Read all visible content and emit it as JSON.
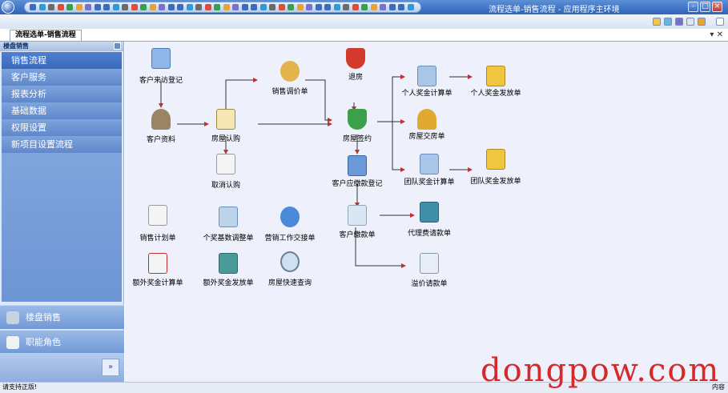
{
  "window": {
    "title": "流程选单-销售流程 - 应用程序主环境"
  },
  "tab": {
    "label": "流程选单-销售流程"
  },
  "sidebar": {
    "header": "楼盘销售",
    "items": [
      {
        "label": "销售流程",
        "selected": true
      },
      {
        "label": "客户服务",
        "selected": false
      },
      {
        "label": "报表分析",
        "selected": false
      },
      {
        "label": "基础数据",
        "selected": false
      },
      {
        "label": "权限设置",
        "selected": false
      },
      {
        "label": "新项目设置流程",
        "selected": false
      }
    ],
    "groups": [
      {
        "label": "楼盘销售",
        "icon": "building-icon"
      },
      {
        "label": "职能角色",
        "icon": "user-role-icon"
      }
    ],
    "more_glyph": "»"
  },
  "flow": {
    "nodes": [
      {
        "id": "visit",
        "label": "客户来访登记",
        "icon": "id-card-icon",
        "color": "#8fb6e8"
      },
      {
        "id": "customer",
        "label": "客户资料",
        "icon": "lock-person-icon",
        "color": "#9a8466"
      },
      {
        "id": "subscribe",
        "label": "房屋认购",
        "icon": "pen-document-icon",
        "color": "#f4e7b3"
      },
      {
        "id": "cancel",
        "label": "取消认购",
        "icon": "cancel-document-icon",
        "color": "#f4f4f4"
      },
      {
        "id": "price",
        "label": "销售调价单",
        "icon": "signing-icon",
        "color": "#e3b34c"
      },
      {
        "id": "return",
        "label": "退房",
        "icon": "red-shield-icon",
        "color": "#d23a2c"
      },
      {
        "id": "contract",
        "label": "房屋签约",
        "icon": "green-shield-icon",
        "color": "#3aa14a"
      },
      {
        "id": "receivable",
        "label": "客户应缴款登记",
        "icon": "calendar-clock-icon",
        "color": "#6c9ad8"
      },
      {
        "id": "payment",
        "label": "客户缴款单",
        "icon": "envelope-icon",
        "color": "#d9e6f3"
      },
      {
        "id": "indiv_calc",
        "label": "个人奖金计算单",
        "icon": "id-card-icon",
        "color": "#a9c6e8"
      },
      {
        "id": "indiv_pay",
        "label": "个人奖金发放单",
        "icon": "sun-card-icon",
        "color": "#f0c640"
      },
      {
        "id": "key",
        "label": "房屋交房单",
        "icon": "key-icon",
        "color": "#e0a92f"
      },
      {
        "id": "team_calc",
        "label": "团队奖金计算单",
        "icon": "cards-icon",
        "color": "#a9c6e8"
      },
      {
        "id": "team_pay",
        "label": "团队奖金发放单",
        "icon": "sun-cards-icon",
        "color": "#f0c640"
      },
      {
        "id": "agent",
        "label": "代理费请款单",
        "icon": "book-icon",
        "color": "#3f8fa6"
      },
      {
        "id": "price_req",
        "label": "溢价请款单",
        "icon": "spreadsheet-icon",
        "color": "#e9eef6"
      },
      {
        "id": "plan",
        "label": "销售计划单",
        "icon": "document-icon",
        "color": "#f4f4f4"
      },
      {
        "id": "base_adj",
        "label": "个奖基数调整单",
        "icon": "edit-card-icon",
        "color": "#bcd3ea"
      },
      {
        "id": "handover",
        "label": "营销工作交接单",
        "icon": "users-icon",
        "color": "#4a8ad8"
      },
      {
        "id": "extra_calc",
        "label": "额外奖金计算单",
        "icon": "card-diamond-icon",
        "color": "#f4f4f4"
      },
      {
        "id": "extra_pay",
        "label": "额外奖金发放单",
        "icon": "book-card-icon",
        "color": "#4a9a9a"
      },
      {
        "id": "query",
        "label": "房屋快速查询",
        "icon": "magnifier-icon",
        "color": "#cfe0f2"
      }
    ]
  },
  "status": {
    "left": "请支持正版!",
    "right": "内容"
  },
  "watermark": "dongpow.com",
  "colors": {
    "accent": "#2f63b8",
    "canvas": "#eef0fb",
    "nav": "#6d95d4",
    "watermark": "#d62a2a"
  }
}
